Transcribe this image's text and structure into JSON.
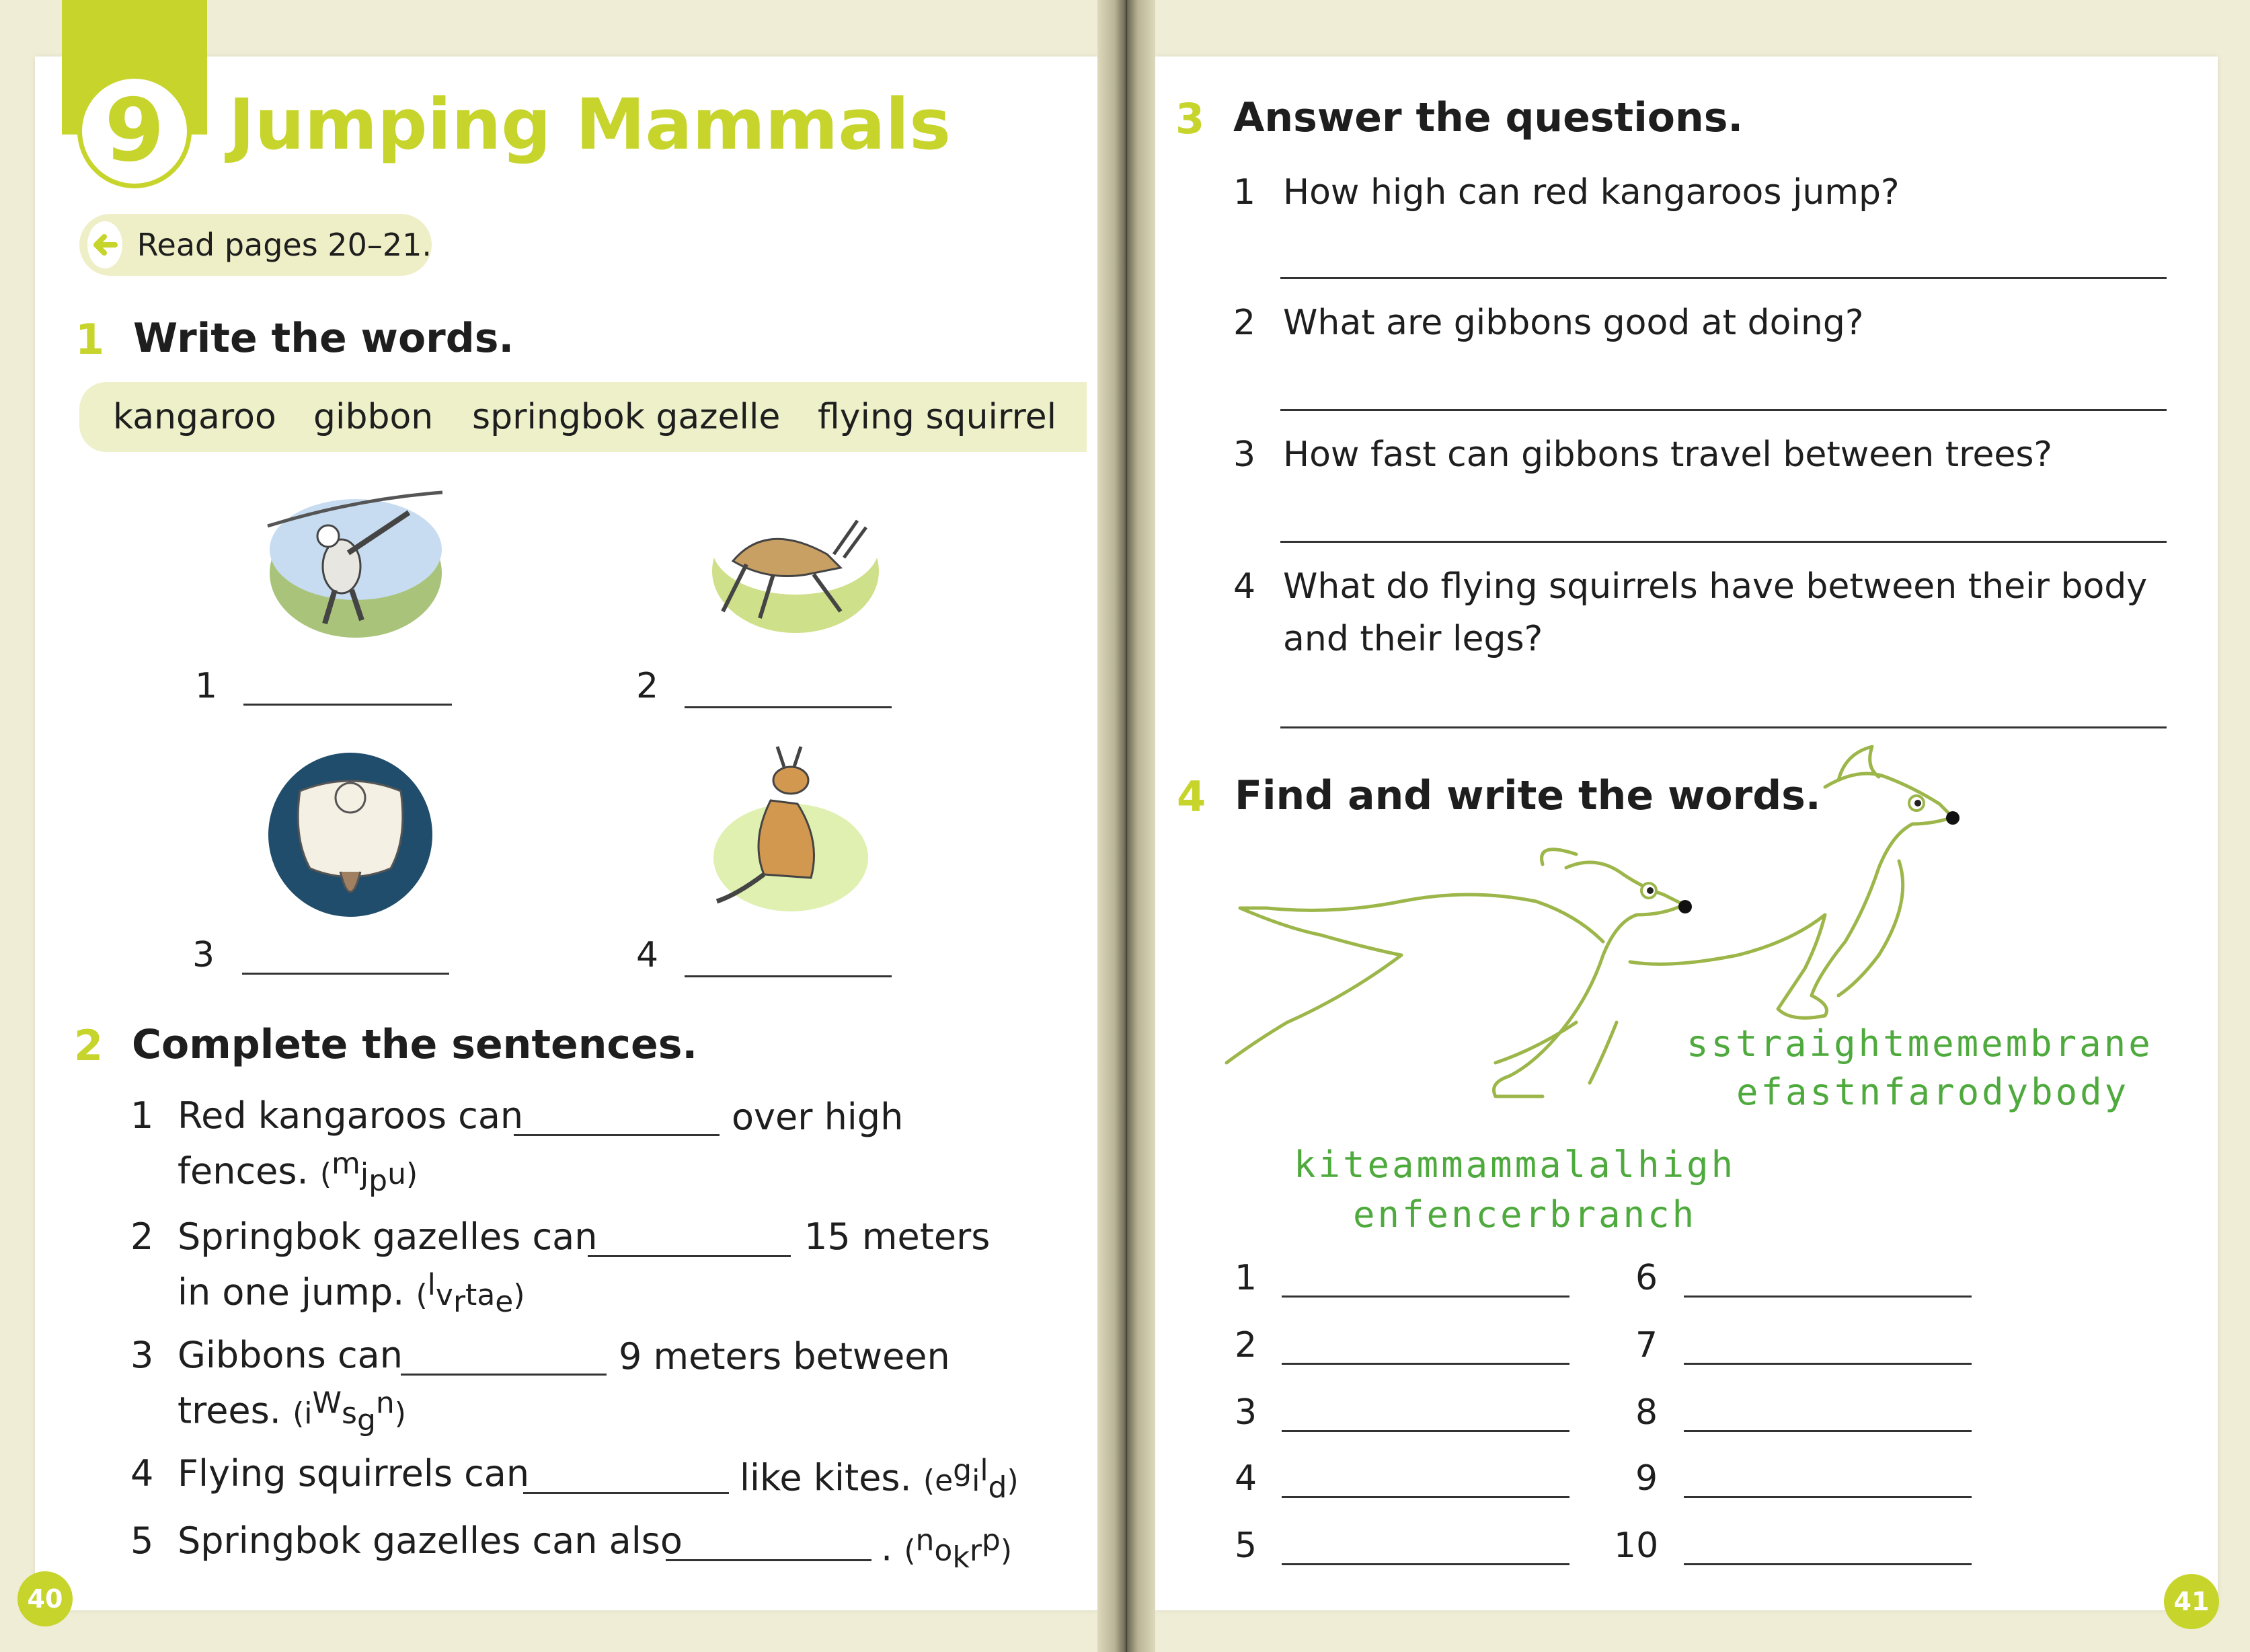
{
  "chapter": {
    "number": "9",
    "title": "Jumping Mammals"
  },
  "read_note": "Read pages 20–21.",
  "exercise1": {
    "number": "1",
    "title": "Write the words.",
    "words": [
      "kangaroo",
      "gibbon",
      "springbok gazelle",
      "flying squirrel"
    ],
    "items": [
      "1",
      "2",
      "3",
      "4"
    ]
  },
  "exercise2": {
    "number": "2",
    "title": "Complete the sentences.",
    "sentences": [
      {
        "n": "1",
        "before": "Red kangaroos can",
        "after": "over high",
        "line2": "fences.",
        "hint": [
          "m",
          "j",
          "p",
          "u"
        ]
      },
      {
        "n": "2",
        "before": "Springbok gazelles can",
        "after": "15 meters",
        "line2": "in one jump.",
        "hint": [
          "l",
          "v",
          "r",
          "t",
          "a",
          "e"
        ]
      },
      {
        "n": "3",
        "before": "Gibbons can",
        "after": "9 meters between",
        "line2": "trees.",
        "hint": [
          "i",
          "W",
          "s",
          "g",
          "n"
        ]
      },
      {
        "n": "4",
        "before": "Flying squirrels can",
        "after": "like kites.",
        "hint": [
          "e",
          "g",
          "i",
          "l",
          "d"
        ]
      },
      {
        "n": "5",
        "before": "Springbok gazelles can also",
        "after": ".",
        "hint": [
          "n",
          "o",
          "k",
          "r",
          "p"
        ]
      }
    ]
  },
  "exercise3": {
    "number": "3",
    "title": "Answer the questions.",
    "questions": [
      {
        "n": "1",
        "text": "How high can red kangaroos jump?"
      },
      {
        "n": "2",
        "text": "What are gibbons good at doing?"
      },
      {
        "n": "3",
        "text": "How fast can gibbons travel between trees?"
      },
      {
        "n": "4",
        "text": "What do flying squirrels have between their body",
        "text2": "and their legs?"
      }
    ]
  },
  "exercise4": {
    "number": "4",
    "title": "Find and write the words.",
    "puzzle_lines": [
      "sstraightmemembrane",
      "efastnfarodybody",
      "kiteammammalalhigh",
      "enfencerbranch"
    ],
    "items": [
      "1",
      "2",
      "3",
      "4",
      "5",
      "6",
      "7",
      "8",
      "9",
      "10"
    ]
  },
  "page_numbers": {
    "left": "40",
    "right": "41"
  },
  "colors": {
    "accent": "#c6d42b",
    "puzzle_green": "#4faa3e",
    "pale": "#eef0c9"
  },
  "icons": {
    "arrow": "arrow-left-icon"
  }
}
